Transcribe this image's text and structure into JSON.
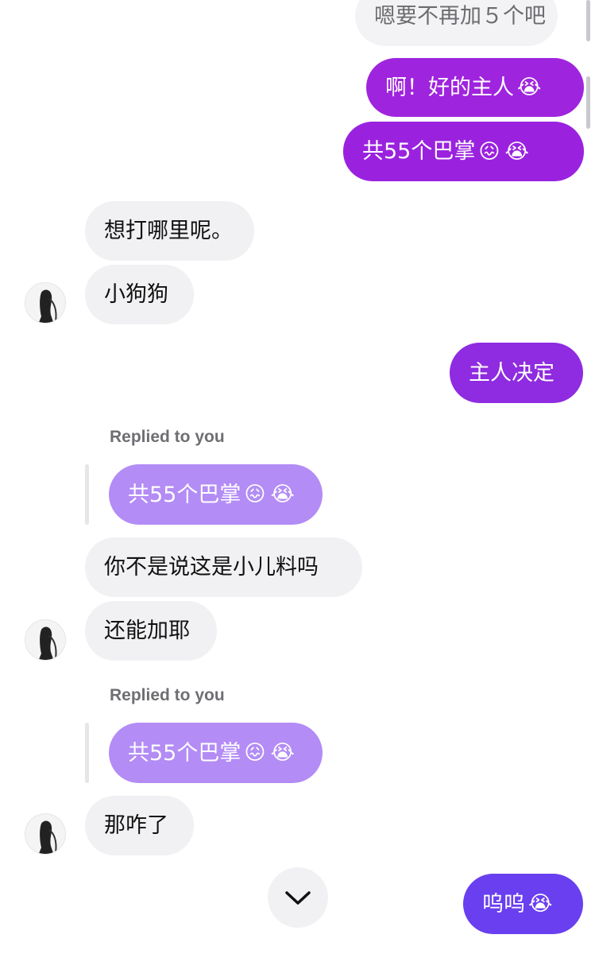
{
  "colors": {
    "incoming_bubble": "#f1f1f3",
    "outgoing_purple": "#9f29dc",
    "outgoing_violet": "#6a3ff0",
    "quoted_bubble": "#b38cf5",
    "meta_text": "#6e6e73"
  },
  "messages": {
    "m1": {
      "text": "嗯要不再加５个吧"
    },
    "m2": {
      "text": "啊！好的主人",
      "emojis": [
        "😭"
      ]
    },
    "m3": {
      "text": "共55个巴掌",
      "emojis": [
        "😖",
        "😭"
      ]
    },
    "m4": {
      "text": "想打哪里呢。"
    },
    "m5": {
      "text": "小狗狗"
    },
    "m6": {
      "text": "主人决定"
    },
    "m7": {
      "reply_label": "Replied to you",
      "quoted": "共55个巴掌",
      "quoted_emojis": [
        "😖",
        "😭"
      ]
    },
    "m8": {
      "text": "你不是说这是小儿料吗"
    },
    "m9": {
      "text": "还能加耶"
    },
    "m10": {
      "reply_label": "Replied to you",
      "quoted": "共55个巴掌",
      "quoted_emojis": [
        "😖",
        "😭"
      ]
    },
    "m11": {
      "text": "那咋了"
    },
    "m12": {
      "text": "呜呜",
      "emojis": [
        "😭"
      ]
    }
  },
  "controls": {
    "scroll_down_icon": "chevron-down-icon"
  }
}
